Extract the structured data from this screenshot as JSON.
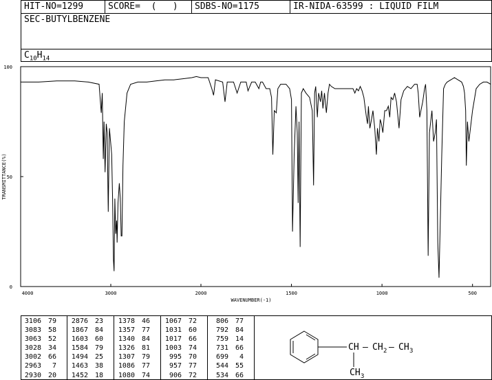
{
  "header": {
    "hit_no": "HIT-NO=1299",
    "score": "SCORE=  (   )",
    "sdbs_no": "SDBS-NO=1175",
    "ir_info": "IR-NIDA-63599 : LIQUID FILM"
  },
  "compound": {
    "name": "SEC-BUTYLBENZENE",
    "formula_c": "C",
    "formula_c_sub": "10",
    "formula_h": "H",
    "formula_h_sub": "14"
  },
  "chart_data": {
    "type": "line",
    "xlabel": "WAVENUMBER(-1)",
    "ylabel": "TRANSMITTANCE(%)",
    "xlim": [
      4000,
      400
    ],
    "ylim": [
      0,
      100
    ],
    "x_ticks": [
      "4000",
      "3000",
      "2000",
      "1500",
      "1000",
      "500"
    ],
    "y_ticks": [
      "100",
      "50",
      "0"
    ],
    "x": [
      4000,
      3800,
      3600,
      3400,
      3250,
      3130,
      3106,
      3095,
      3083,
      3075,
      3063,
      3050,
      3040,
      3028,
      3015,
      3002,
      2990,
      2980,
      2970,
      2963,
      2955,
      2945,
      2935,
      2930,
      2920,
      2905,
      2895,
      2885,
      2876,
      2865,
      2850,
      2820,
      2780,
      2700,
      2600,
      2500,
      2400,
      2300,
      2200,
      2100,
      2050,
      2000,
      1960,
      1940,
      1930,
      1920,
      1880,
      1867,
      1855,
      1820,
      1800,
      1780,
      1750,
      1740,
      1720,
      1700,
      1680,
      1670,
      1660,
      1640,
      1620,
      1610,
      1603,
      1595,
      1584,
      1575,
      1560,
      1530,
      1510,
      1500,
      1494,
      1485,
      1475,
      1468,
      1463,
      1458,
      1452,
      1445,
      1435,
      1420,
      1400,
      1385,
      1378,
      1372,
      1366,
      1357,
      1350,
      1340,
      1333,
      1326,
      1318,
      1307,
      1298,
      1290,
      1280,
      1260,
      1240,
      1220,
      1200,
      1180,
      1160,
      1150,
      1140,
      1130,
      1120,
      1110,
      1100,
      1086,
      1080,
      1075,
      1067,
      1060,
      1050,
      1040,
      1031,
      1025,
      1017,
      1010,
      1003,
      995,
      985,
      975,
      965,
      957,
      950,
      940,
      930,
      920,
      906,
      895,
      880,
      860,
      840,
      820,
      806,
      800,
      792,
      785,
      775,
      765,
      759,
      752,
      745,
      738,
      731,
      724,
      715,
      706,
      699,
      692,
      685,
      670,
      660,
      650,
      640,
      620,
      600,
      580,
      560,
      550,
      544,
      538,
      534,
      528,
      520,
      500,
      480,
      460,
      440,
      420,
      400
    ],
    "y": [
      93,
      93,
      93.5,
      93.5,
      93,
      92,
      79,
      88,
      58,
      75,
      52,
      74,
      70,
      34,
      72,
      66,
      60,
      40,
      12,
      7,
      40,
      24,
      30,
      20,
      38,
      47,
      40,
      23,
      23,
      55,
      75,
      88,
      92,
      93,
      93,
      93.5,
      94,
      94,
      94.5,
      95,
      95.5,
      95,
      95,
      90,
      87,
      94,
      93,
      84,
      93,
      93,
      88,
      93,
      93,
      89,
      93,
      93,
      90,
      93,
      93,
      90,
      90,
      86,
      60,
      80,
      79,
      90,
      92,
      92,
      90,
      85,
      25,
      60,
      82,
      70,
      38,
      75,
      18,
      88,
      90,
      88,
      86,
      80,
      46,
      88,
      91,
      77,
      88,
      84,
      89,
      81,
      88,
      79,
      88,
      92,
      91,
      90,
      90,
      90,
      90,
      90,
      90,
      88,
      90,
      89,
      91,
      89,
      86,
      77,
      74,
      82,
      72,
      75,
      80,
      72,
      60,
      72,
      66,
      76,
      74,
      70,
      80,
      80,
      82,
      77,
      86,
      85,
      88,
      84,
      72,
      85,
      89,
      91,
      90,
      92,
      92,
      88,
      77,
      80,
      84,
      90,
      92,
      80,
      14,
      70,
      75,
      80,
      66,
      70,
      76,
      20,
      4,
      60,
      90,
      92,
      93,
      94,
      95,
      94,
      93,
      91,
      88,
      80,
      55,
      75,
      66,
      80,
      90,
      92,
      93,
      93,
      92,
      86,
      78
    ],
    "peaks": [
      {
        "wn": "3106",
        "t": "79"
      },
      {
        "wn": "3083",
        "t": "58"
      },
      {
        "wn": "3063",
        "t": "52"
      },
      {
        "wn": "3028",
        "t": "34"
      },
      {
        "wn": "3002",
        "t": "66"
      },
      {
        "wn": "2963",
        "t": "7"
      },
      {
        "wn": "2930",
        "t": "20"
      },
      {
        "wn": "2876",
        "t": "23"
      },
      {
        "wn": "1867",
        "t": "84"
      },
      {
        "wn": "1603",
        "t": "60"
      },
      {
        "wn": "1584",
        "t": "79"
      },
      {
        "wn": "1494",
        "t": "25"
      },
      {
        "wn": "1463",
        "t": "38"
      },
      {
        "wn": "1452",
        "t": "18"
      },
      {
        "wn": "1378",
        "t": "46"
      },
      {
        "wn": "1357",
        "t": "77"
      },
      {
        "wn": "1340",
        "t": "84"
      },
      {
        "wn": "1326",
        "t": "81"
      },
      {
        "wn": "1307",
        "t": "79"
      },
      {
        "wn": "1086",
        "t": "77"
      },
      {
        "wn": "1080",
        "t": "74"
      },
      {
        "wn": "1067",
        "t": "72"
      },
      {
        "wn": "1031",
        "t": "60"
      },
      {
        "wn": "1017",
        "t": "66"
      },
      {
        "wn": "1003",
        "t": "74"
      },
      {
        "wn": "995",
        "t": "70"
      },
      {
        "wn": "957",
        "t": "77"
      },
      {
        "wn": "906",
        "t": "72"
      },
      {
        "wn": "806",
        "t": "77"
      },
      {
        "wn": "792",
        "t": "84"
      },
      {
        "wn": "759",
        "t": "14"
      },
      {
        "wn": "731",
        "t": "66"
      },
      {
        "wn": "699",
        "t": "4"
      },
      {
        "wn": "544",
        "t": "55"
      },
      {
        "wn": "534",
        "t": "66"
      }
    ]
  },
  "structure": {
    "ch": "CH",
    "dash1": "—",
    "ch2": "CH",
    "ch2_sub": "2",
    "dash2": "—",
    "ch3": "CH",
    "ch3_sub": "3",
    "branch_ch3": "CH",
    "branch_ch3_sub": "3"
  }
}
